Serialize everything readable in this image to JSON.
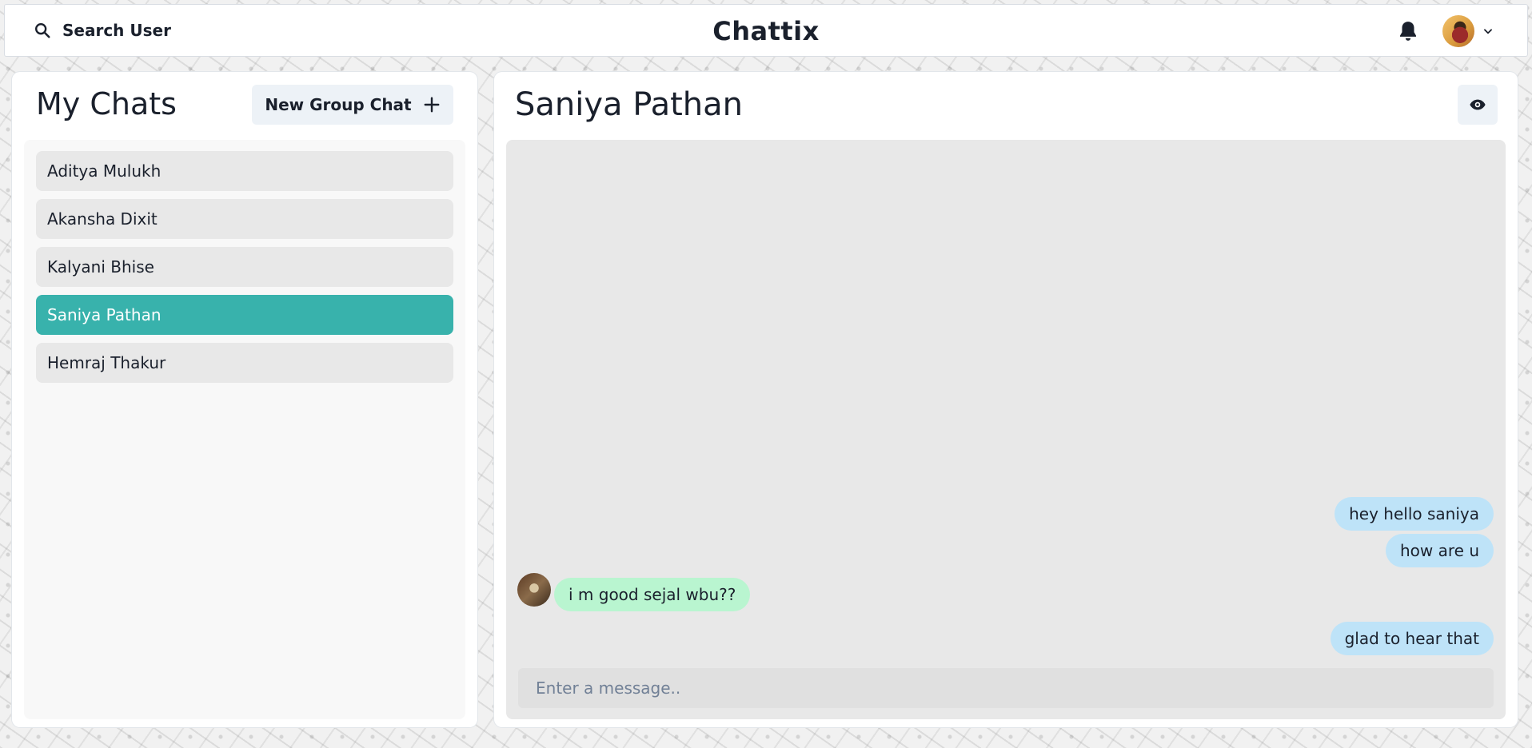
{
  "header": {
    "search_label": "Search User",
    "app_title": "Chattix"
  },
  "sidebar": {
    "title": "My Chats",
    "new_group_label": "New Group Chat",
    "chats": [
      {
        "name": "Aditya Mulukh",
        "active": false
      },
      {
        "name": "Akansha Dixit",
        "active": false
      },
      {
        "name": "Kalyani Bhise",
        "active": false
      },
      {
        "name": "Saniya Pathan",
        "active": true
      },
      {
        "name": "Hemraj Thakur",
        "active": false
      }
    ]
  },
  "chat": {
    "name": "Saniya Pathan",
    "messages": [
      {
        "text": "hey hello saniya",
        "from": "me"
      },
      {
        "text": "how are u",
        "from": "me"
      },
      {
        "text": "i m good sejal wbu??",
        "from": "other"
      },
      {
        "text": "glad to hear that",
        "from": "me"
      }
    ],
    "input_placeholder": "Enter a message.."
  },
  "colors": {
    "accent": "#38b2ac",
    "sent_bubble": "#bee3f8",
    "received_bubble": "#b9f5d0"
  },
  "icons": [
    "search-icon",
    "bell-icon",
    "chevron-down-icon",
    "plus-icon",
    "eye-icon"
  ]
}
